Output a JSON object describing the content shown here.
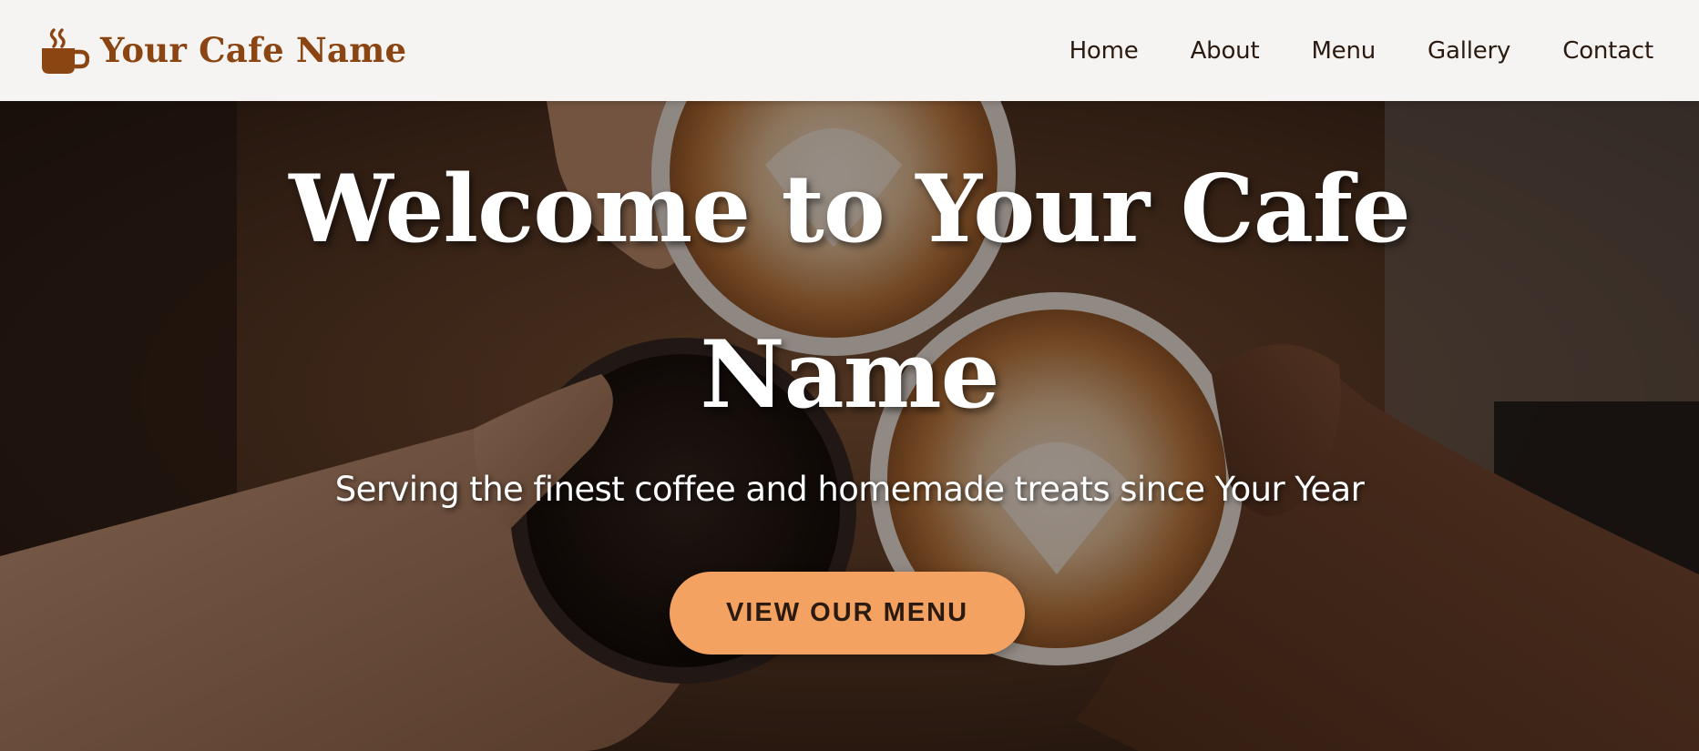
{
  "header": {
    "brand_name": "Your Cafe Name",
    "brand_icon": "coffee-cup-icon",
    "nav": [
      {
        "label": "Home"
      },
      {
        "label": "About"
      },
      {
        "label": "Menu"
      },
      {
        "label": "Gallery"
      },
      {
        "label": "Contact"
      }
    ]
  },
  "hero": {
    "title": "Welcome to Your Cafe Name",
    "subtitle": "Serving the finest coffee and homemade treats since Your Year",
    "cta_label": "VIEW OUR MENU",
    "background": "hands-toasting-coffee-cups-photo"
  },
  "colors": {
    "brand": "#8b4513",
    "nav_text": "#2b1a10",
    "header_bg": "#f6f4f2",
    "cta_bg": "#f4a261",
    "hero_text": "#ffffff"
  }
}
